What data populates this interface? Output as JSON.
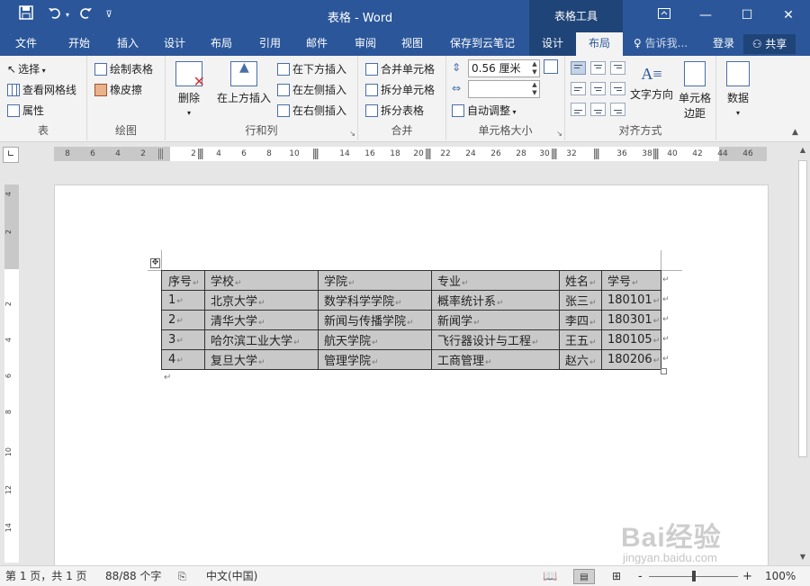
{
  "window": {
    "title": "表格 - Word",
    "context_tab_title": "表格工具",
    "colors": {
      "title_bar": "#2b579a",
      "context_tab": "#1f4478",
      "ribbon_bg": "#f3f3f3"
    }
  },
  "quick_access": {
    "icons": [
      "save-icon",
      "undo-icon",
      "redo-icon",
      "customize-icon"
    ]
  },
  "tabs": [
    {
      "label": "文件"
    },
    {
      "label": "开始"
    },
    {
      "label": "插入"
    },
    {
      "label": "设计"
    },
    {
      "label": "布局"
    },
    {
      "label": "引用"
    },
    {
      "label": "邮件"
    },
    {
      "label": "审阅"
    },
    {
      "label": "视图"
    },
    {
      "label": "保存到云笔记"
    },
    {
      "label": "设计"
    },
    {
      "label": "布局"
    }
  ],
  "tell_me": "告诉我...",
  "signin": "登录",
  "share": "共享",
  "ribbon": {
    "table_group": {
      "label": "表",
      "select": "选择",
      "view_gridlines": "查看网格线",
      "properties": "属性"
    },
    "draw_group": {
      "label": "绘图",
      "draw_table": "绘制表格",
      "eraser": "橡皮擦"
    },
    "rows_cols_group": {
      "label": "行和列",
      "delete": "删除",
      "insert_above": "在上方插入",
      "insert_below": "在下方插入",
      "insert_left": "在左侧插入",
      "insert_right": "在右侧插入"
    },
    "merge_group": {
      "label": "合并",
      "merge_cells": "合并单元格",
      "split_cells": "拆分单元格",
      "split_table": "拆分表格"
    },
    "cell_size_group": {
      "label": "单元格大小",
      "height_value": "0.56 厘米",
      "width_value": "",
      "autofit": "自动调整"
    },
    "alignment_group": {
      "label": "对齐方式",
      "text_direction_line1": "文字方向",
      "cell_margins_line1": "单元格",
      "cell_margins_line2": "边距"
    },
    "data_group": {
      "label": "数据"
    }
  },
  "ruler": {
    "ticks": [
      "8",
      "6",
      "4",
      "2",
      "2",
      "4",
      "6",
      "8",
      "10",
      "14",
      "16",
      "18",
      "20",
      "22",
      "24",
      "26",
      "28",
      "30",
      "32",
      "36",
      "38",
      "40",
      "42",
      "44",
      "46"
    ],
    "vticks": [
      "4",
      "2",
      "2",
      "4",
      "6",
      "8",
      "10",
      "12",
      "14"
    ]
  },
  "table": {
    "rows": [
      [
        "序号",
        "学校",
        "学院",
        "专业",
        "姓名",
        "学号"
      ],
      [
        "1",
        "北京大学",
        "数学科学学院",
        "概率统计系",
        "张三",
        "180101"
      ],
      [
        "2",
        "清华大学",
        "新闻与传播学院",
        "新闻学",
        "李四",
        "180301"
      ],
      [
        "3",
        "哈尔滨工业大学",
        "航天学院",
        "飞行器设计与工程",
        "王五",
        "180105"
      ],
      [
        "4",
        "复旦大学",
        "管理学院",
        "工商管理",
        "赵六",
        "180206"
      ]
    ],
    "marker": "↵"
  },
  "status": {
    "page": "第 1 页，共 1 页",
    "word_count": "88/88 个字",
    "language": "中文(中国)",
    "zoom": "100%",
    "zoom_minus": "-",
    "zoom_plus": "+"
  },
  "watermark": {
    "main": "Bai经验",
    "sub": "jingyan.baidu.com"
  }
}
